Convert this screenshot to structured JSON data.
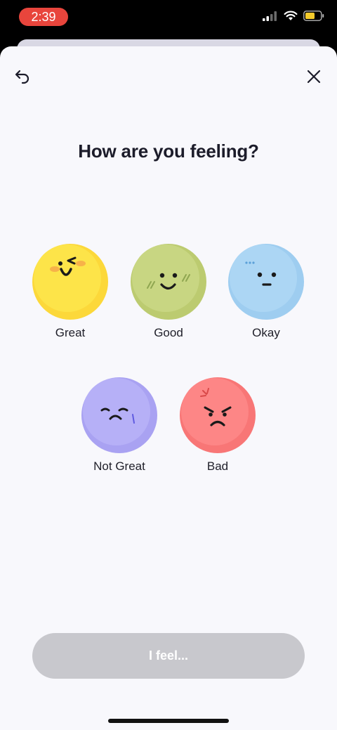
{
  "status_bar": {
    "time": "2:39",
    "icons": [
      "cellular-signal-icon",
      "wifi-icon",
      "battery-icon"
    ]
  },
  "header": {
    "back_icon": "undo-arrow-icon",
    "close_icon": "close-icon"
  },
  "title": "How are you feeling?",
  "moods": [
    {
      "label": "Great",
      "color": "#fde047"
    },
    {
      "label": "Good",
      "color": "#c6d37f"
    },
    {
      "label": "Okay",
      "color": "#a9d4f3"
    },
    {
      "label": "Not Great",
      "color": "#b4aef6"
    },
    {
      "label": "Bad",
      "color": "#fb8080"
    }
  ],
  "cta": {
    "label": "I feel...",
    "enabled": false
  }
}
